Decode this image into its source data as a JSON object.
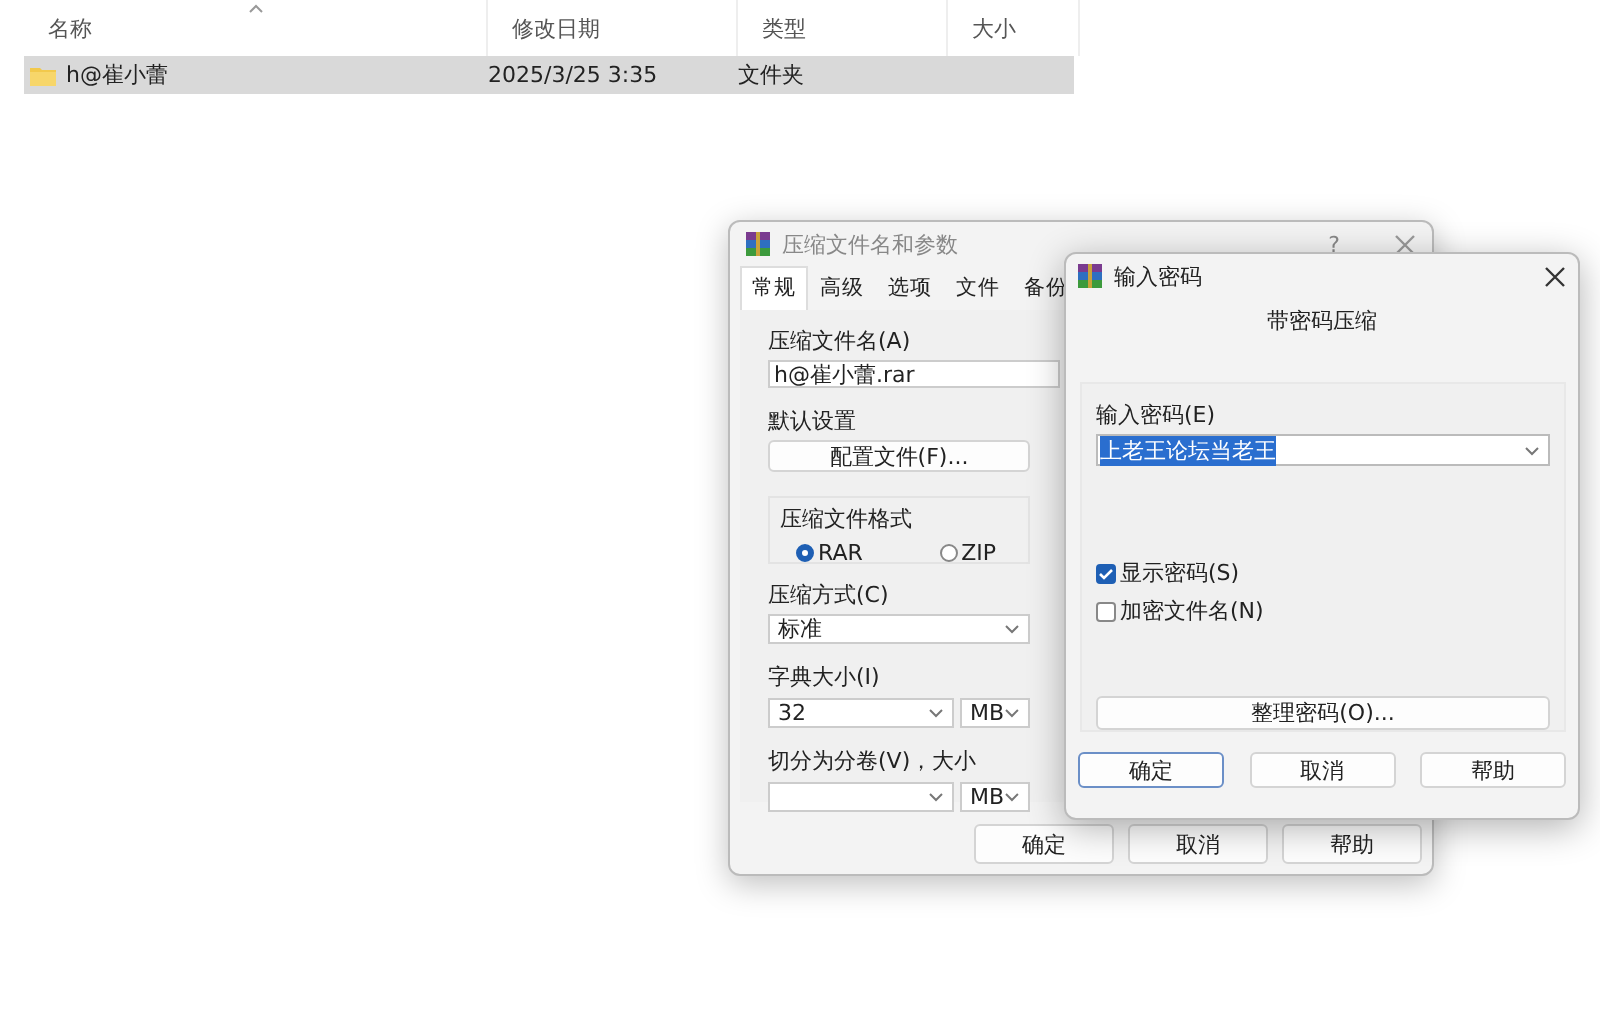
{
  "file_list": {
    "columns": [
      {
        "label": "名称",
        "sorted": true
      },
      {
        "label": "修改日期",
        "sorted": false
      },
      {
        "label": "类型",
        "sorted": false
      },
      {
        "label": "大小",
        "sorted": false
      }
    ],
    "rows": [
      {
        "name": "h@崔小蕾",
        "modified": "2025/3/25 3:35",
        "type": "文件夹",
        "selected": true
      }
    ]
  },
  "archive_dialog": {
    "title": "压缩文件名和参数",
    "help": "?",
    "tabs": [
      {
        "label": "常规",
        "selected": true
      },
      {
        "label": "高级",
        "selected": false
      },
      {
        "label": "选项",
        "selected": false
      },
      {
        "label": "文件",
        "selected": false
      },
      {
        "label": "备份",
        "selected": false
      }
    ],
    "archive_name_label": "压缩文件名(A)",
    "archive_name": "h@崔小蕾.rar",
    "default_settings_label": "默认设置",
    "profiles_button": "配置文件(F)...",
    "format_group": {
      "label": "压缩文件格式",
      "options": [
        {
          "label": "RAR",
          "selected": true
        },
        {
          "label": "ZIP",
          "selected": false
        }
      ]
    },
    "method_label": "压缩方式(C)",
    "method": "标准",
    "dictionary_label": "字典大小(I)",
    "dictionary": "32",
    "dictionary_unit": "MB",
    "split_label": "切分为分卷(V)，大小",
    "split_unit": "MB",
    "buttons": [
      "确定",
      "取消",
      "帮助"
    ]
  },
  "password_dialog": {
    "title": "输入密码",
    "subtitle": "带密码压缩",
    "password_label": "输入密码(E)",
    "password": "上老王论坛当老王",
    "password_selected": true,
    "options": [
      {
        "label": "显示密码(S)",
        "checked": true
      },
      {
        "label": "加密文件名(N)",
        "checked": false
      }
    ],
    "organize_button": "整理密码(O)...",
    "buttons": [
      {
        "label": "确定",
        "default": true
      },
      {
        "label": "取消",
        "default": false
      },
      {
        "label": "帮助",
        "default": false
      }
    ]
  }
}
